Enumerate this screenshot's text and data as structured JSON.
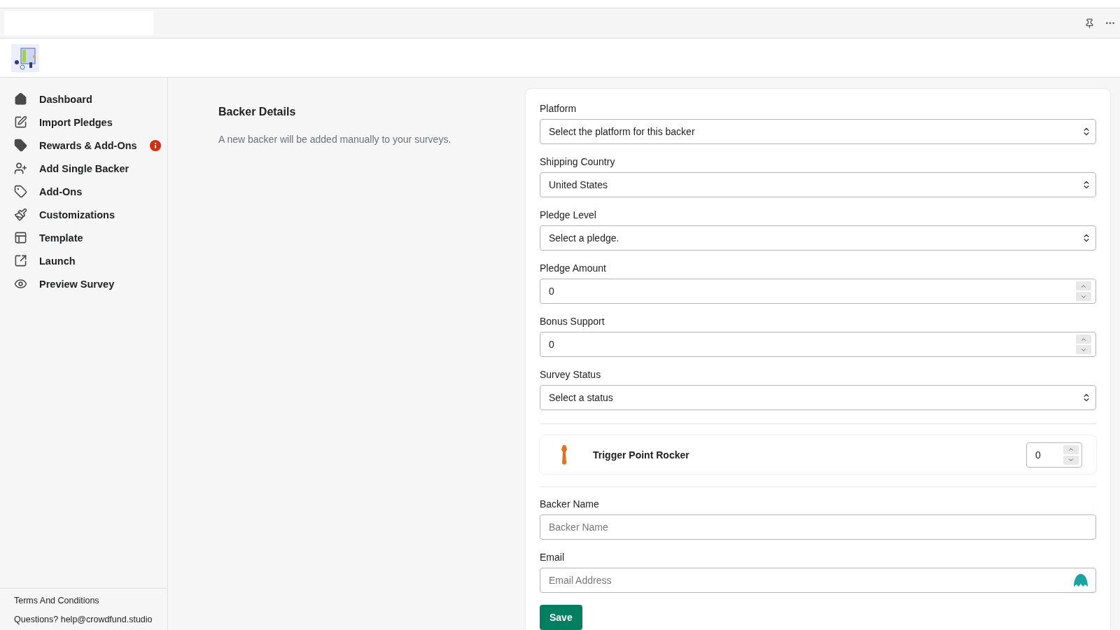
{
  "sidebar": {
    "items": [
      {
        "label": "Dashboard",
        "alert": false
      },
      {
        "label": "Import Pledges",
        "alert": false
      },
      {
        "label": "Rewards & Add-Ons",
        "alert": true
      },
      {
        "label": "Add Single Backer",
        "alert": false
      },
      {
        "label": "Add-Ons",
        "alert": false
      },
      {
        "label": "Customizations",
        "alert": false
      },
      {
        "label": "Template",
        "alert": false
      },
      {
        "label": "Launch",
        "alert": false
      },
      {
        "label": "Preview Survey",
        "alert": false
      }
    ],
    "footer": [
      "Terms And Conditions",
      "Questions? help@crowdfund.studio"
    ]
  },
  "intro": {
    "title": "Backer Details",
    "description": "A new backer will be added manually to your surveys."
  },
  "fields": [
    {
      "kind": "select",
      "label": "Platform",
      "value": "Select the platform for this backer"
    },
    {
      "kind": "select",
      "label": "Shipping Country",
      "value": "United States"
    },
    {
      "kind": "select",
      "label": "Pledge Level",
      "value": "Select a pledge."
    },
    {
      "kind": "number",
      "label": "Pledge Amount",
      "value": "0"
    },
    {
      "kind": "number",
      "label": "Bonus Support",
      "value": "0"
    },
    {
      "kind": "select",
      "label": "Survey Status",
      "value": "Select a status"
    }
  ],
  "addons": [
    {
      "name": "Trigger Point Rocker",
      "quantity": "0"
    }
  ],
  "contact_fields": [
    {
      "kind": "text",
      "label": "Backer Name",
      "placeholder": "Backer Name"
    },
    {
      "kind": "email",
      "label": "Email",
      "placeholder": "Email Address"
    }
  ],
  "save_button": "Save"
}
